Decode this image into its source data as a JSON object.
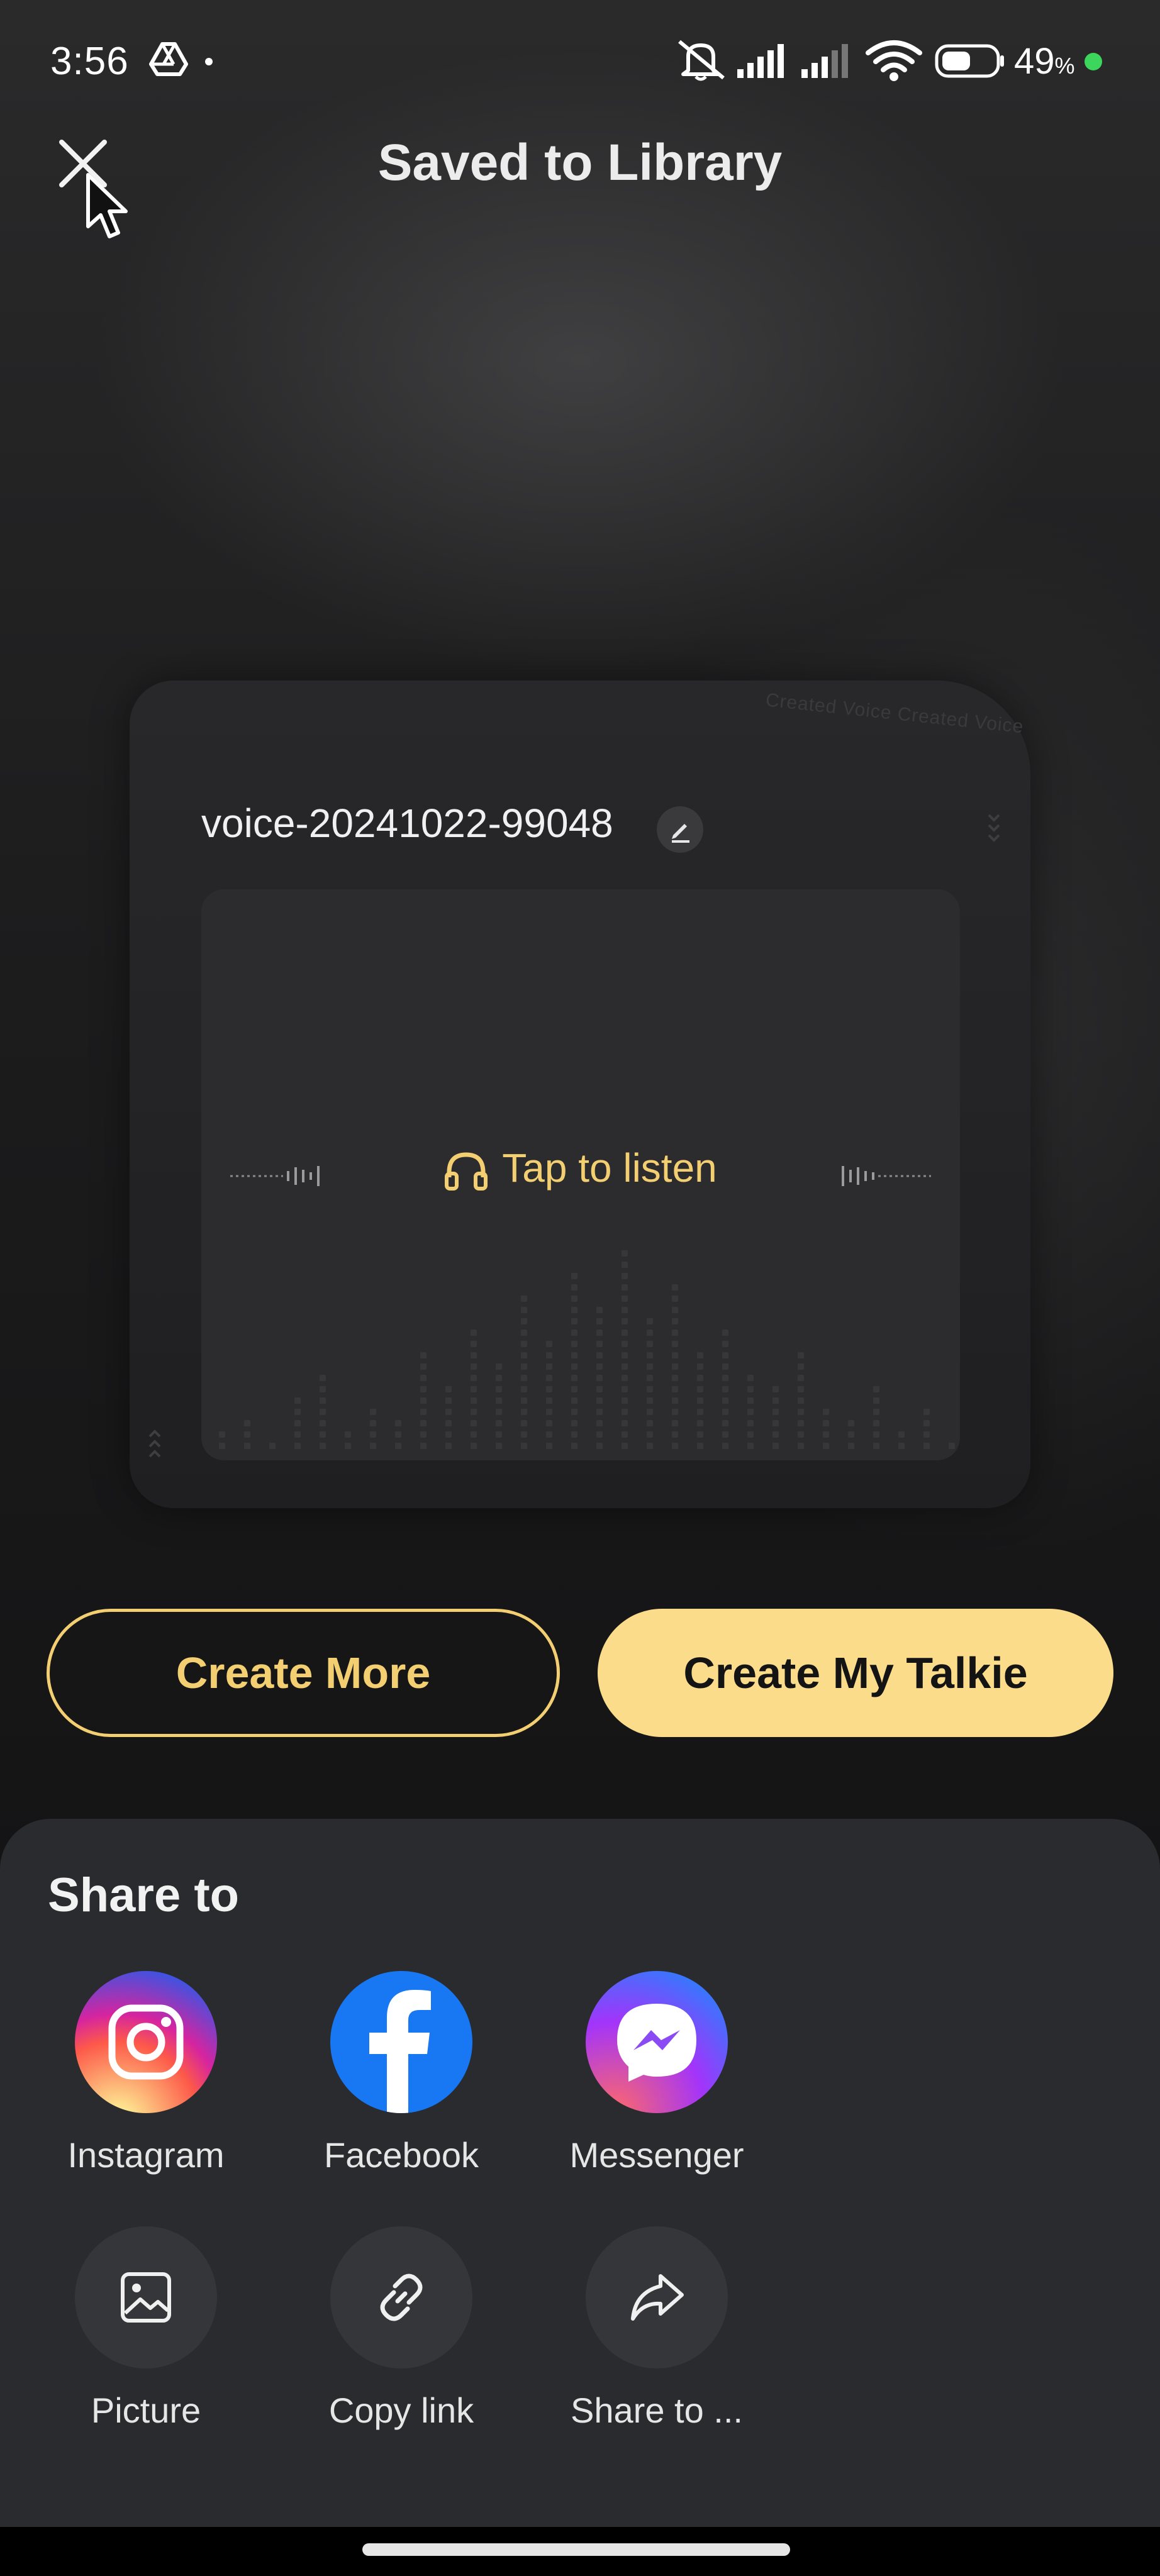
{
  "status_bar": {
    "time": "3:56",
    "battery_percent": "49",
    "battery_unit": "%",
    "icons": [
      "drive-icon",
      "mute-icon",
      "signal-icon",
      "signal-icon",
      "wifi-icon",
      "battery-icon"
    ]
  },
  "header": {
    "title": "Saved to Library",
    "close_icon": "close-icon"
  },
  "card": {
    "watermark": "Created Voice Created Voice",
    "voice_name": "voice-20241022-99048",
    "listen_label": "Tap to listen",
    "listen_icon": "headphones-icon",
    "edit_icon": "pencil-icon"
  },
  "actions": {
    "create_more": "Create More",
    "create_talkie": "Create My Talkie"
  },
  "share": {
    "title": "Share to",
    "items": [
      {
        "label": "Instagram",
        "icon": "instagram-icon"
      },
      {
        "label": "Facebook",
        "icon": "facebook-icon"
      },
      {
        "label": "Messenger",
        "icon": "messenger-icon"
      },
      {
        "label": "Picture",
        "icon": "picture-icon"
      },
      {
        "label": "Copy link",
        "icon": "link-icon"
      },
      {
        "label": "Share to ...",
        "icon": "share-icon"
      }
    ]
  },
  "colors": {
    "accent": "#f3cf72",
    "accent_fill": "#fbdc8a",
    "background": "#1b1b1c",
    "sheet": "#2a2b2e"
  }
}
